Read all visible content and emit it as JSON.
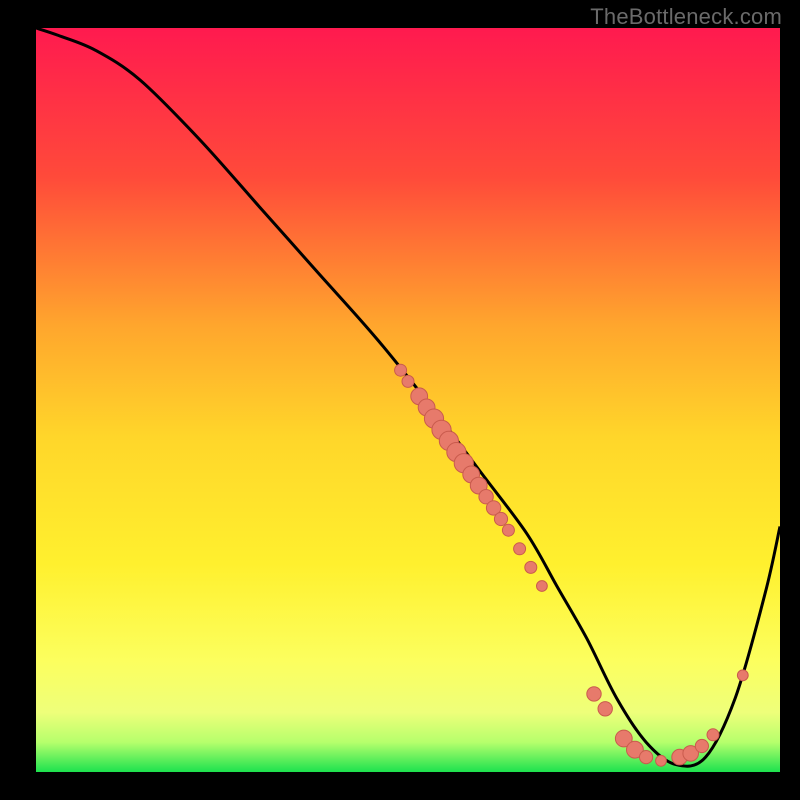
{
  "watermark": "TheBottleneck.com",
  "colors": {
    "background": "#000000",
    "gradient_stops": [
      {
        "offset": 0.0,
        "color": "#ff1a4f"
      },
      {
        "offset": 0.2,
        "color": "#ff4a3a"
      },
      {
        "offset": 0.4,
        "color": "#ffa62d"
      },
      {
        "offset": 0.55,
        "color": "#ffd62a"
      },
      {
        "offset": 0.72,
        "color": "#fff02e"
      },
      {
        "offset": 0.85,
        "color": "#fcff5e"
      },
      {
        "offset": 0.92,
        "color": "#eeff7a"
      },
      {
        "offset": 0.96,
        "color": "#b6ff6c"
      },
      {
        "offset": 1.0,
        "color": "#1de24f"
      }
    ],
    "curve": "#000000",
    "point_fill": "#e77a6b",
    "point_stroke": "#c95b4d"
  },
  "chart_data": {
    "type": "line",
    "title": "",
    "xlabel": "",
    "ylabel": "",
    "xlim": [
      0,
      100
    ],
    "ylim": [
      0,
      100
    ],
    "series": [
      {
        "name": "curve",
        "x": [
          0,
          3,
          8,
          14,
          22,
          30,
          38,
          46,
          54,
          60,
          66,
          70,
          74,
          78,
          82,
          86,
          90,
          94,
          98,
          100
        ],
        "y": [
          100,
          99,
          97,
          93,
          85,
          76,
          67,
          58,
          48,
          40,
          32,
          25,
          18,
          10,
          4,
          1,
          2,
          10,
          24,
          33
        ]
      }
    ],
    "points": [
      {
        "x": 49,
        "y": 54,
        "r": 1.0
      },
      {
        "x": 50,
        "y": 52.5,
        "r": 1.0
      },
      {
        "x": 51.5,
        "y": 50.5,
        "r": 1.4
      },
      {
        "x": 52.5,
        "y": 49,
        "r": 1.4
      },
      {
        "x": 53.5,
        "y": 47.5,
        "r": 1.6
      },
      {
        "x": 54.5,
        "y": 46,
        "r": 1.6
      },
      {
        "x": 55.5,
        "y": 44.5,
        "r": 1.6
      },
      {
        "x": 56.5,
        "y": 43,
        "r": 1.6
      },
      {
        "x": 57.5,
        "y": 41.5,
        "r": 1.6
      },
      {
        "x": 58.5,
        "y": 40,
        "r": 1.4
      },
      {
        "x": 59.5,
        "y": 38.5,
        "r": 1.4
      },
      {
        "x": 60.5,
        "y": 37,
        "r": 1.2
      },
      {
        "x": 61.5,
        "y": 35.5,
        "r": 1.2
      },
      {
        "x": 62.5,
        "y": 34,
        "r": 1.1
      },
      {
        "x": 63.5,
        "y": 32.5,
        "r": 1.0
      },
      {
        "x": 65,
        "y": 30,
        "r": 1.0
      },
      {
        "x": 66.5,
        "y": 27.5,
        "r": 1.0
      },
      {
        "x": 68,
        "y": 25,
        "r": 0.9
      },
      {
        "x": 75,
        "y": 10.5,
        "r": 1.2
      },
      {
        "x": 76.5,
        "y": 8.5,
        "r": 1.2
      },
      {
        "x": 79,
        "y": 4.5,
        "r": 1.4
      },
      {
        "x": 80.5,
        "y": 3,
        "r": 1.4
      },
      {
        "x": 82,
        "y": 2,
        "r": 1.1
      },
      {
        "x": 84,
        "y": 1.5,
        "r": 0.9
      },
      {
        "x": 86.5,
        "y": 2,
        "r": 1.3
      },
      {
        "x": 88,
        "y": 2.5,
        "r": 1.3
      },
      {
        "x": 89.5,
        "y": 3.5,
        "r": 1.1
      },
      {
        "x": 91,
        "y": 5,
        "r": 1.0
      },
      {
        "x": 95,
        "y": 13,
        "r": 0.9
      }
    ]
  }
}
